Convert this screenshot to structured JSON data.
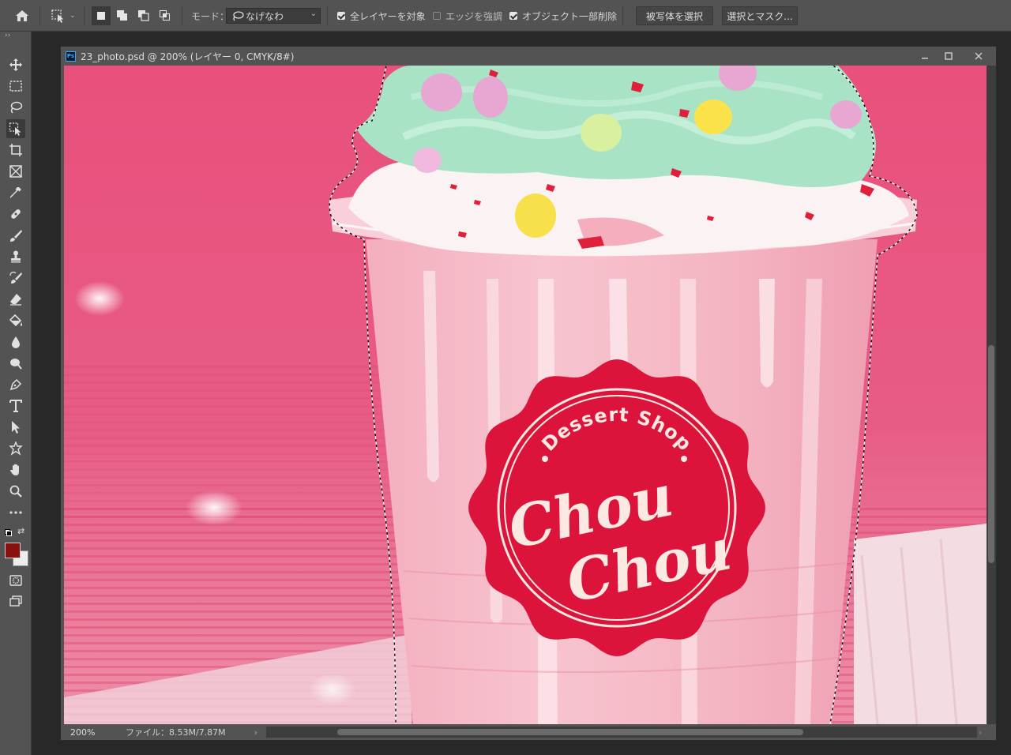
{
  "options": {
    "mode_label": "モード：",
    "mode_value": "なげなわ",
    "all_layers_label": "全レイヤーを対象",
    "all_layers_checked": true,
    "enhance_edge_label": "エッジを強調",
    "enhance_edge_checked": false,
    "object_subtract_label": "オブジェクト一部削除",
    "object_subtract_checked": true,
    "select_subject_label": "被写体を選択",
    "select_mask_label": "選択とマスク..."
  },
  "document": {
    "title": "23_photo.psd @ 200% (レイヤー 0, CMYK/8#)",
    "app_badge": "Ps"
  },
  "status": {
    "zoom": "200%",
    "file_info": "ファイル：8.53M/7.87M"
  },
  "logo": {
    "top_text": "Dessert Shop",
    "line1": "Chou",
    "line2": "Chou"
  },
  "colors": {
    "foreground": "#8a1010",
    "background": "#ededed",
    "accent_red": "#dc143c"
  },
  "toolbar": {
    "items": [
      "move-icon",
      "marquee-icon",
      "lasso-icon",
      "object-select-icon",
      "crop-icon",
      "frame-icon",
      "eyedropper-icon",
      "healing-icon",
      "brush-icon",
      "stamp-icon",
      "history-brush-icon",
      "eraser-icon",
      "paint-bucket-icon",
      "blur-icon",
      "dodge-icon",
      "pen-icon",
      "type-icon",
      "path-select-icon",
      "custom-shape-icon",
      "hand-icon",
      "zoom-icon",
      "more-icon"
    ]
  }
}
